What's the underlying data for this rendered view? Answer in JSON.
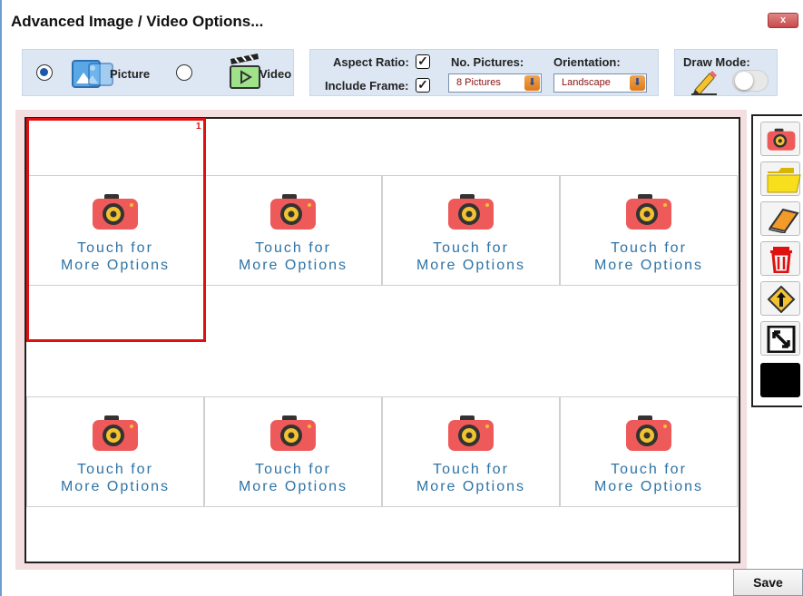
{
  "window": {
    "title": "Advanced Image / Video Options...",
    "close_label": "x"
  },
  "media_type": {
    "options": [
      {
        "label": "Picture",
        "selected": true,
        "icon": "picture-icon"
      },
      {
        "label": "Video",
        "selected": false,
        "icon": "video-clapper-icon"
      }
    ]
  },
  "layout_options": {
    "aspect_ratio_label": "Aspect Ratio:",
    "aspect_ratio_checked": true,
    "include_frame_label": "Include Frame:",
    "include_frame_checked": true,
    "check_mark": "✓",
    "no_pictures_label": "No. Pictures:",
    "no_pictures_value": "8 Pictures",
    "orientation_label": "Orientation:",
    "orientation_value": "Landscape"
  },
  "draw_mode": {
    "label": "Draw Mode:",
    "enabled": false
  },
  "grid": {
    "selected_index_label": "1",
    "cells": [
      {
        "line1": "Touch for",
        "line2": "More Options"
      },
      {
        "line1": "Touch for",
        "line2": "More Options"
      },
      {
        "line1": "Touch for",
        "line2": "More Options"
      },
      {
        "line1": "Touch for",
        "line2": "More Options"
      },
      {
        "line1": "Touch for",
        "line2": "More Options"
      },
      {
        "line1": "Touch for",
        "line2": "More Options"
      },
      {
        "line1": "Touch for",
        "line2": "More Options"
      },
      {
        "line1": "Touch for",
        "line2": "More Options"
      }
    ]
  },
  "toolbar": {
    "tools": [
      "camera-icon",
      "folder-icon",
      "book-icon",
      "trash-icon",
      "merge-sign-icon",
      "resize-icon",
      "color-swatch"
    ]
  },
  "colors": {
    "accent": "#1f57a8",
    "selection": "#e01010",
    "cell_text": "#2d73a6",
    "camera": "#ee5a5a"
  },
  "footer": {
    "save_label": "Save"
  }
}
